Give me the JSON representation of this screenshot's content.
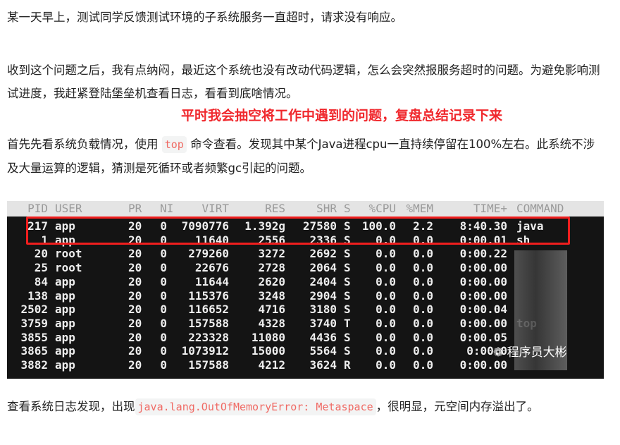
{
  "paragraphs": [
    {
      "text": "某一天早上，测试同学反馈测试环境的子系统服务一直超时，请求没有响应。"
    },
    {
      "text": "收到这个问题之后，我有点纳闷，最近这个系统也没有改动代码逻辑，怎么会突然报服务超时的问题。为避免影响测试进度，我赶紧登陆堡垒机查看日志，看看到底啥情况。"
    }
  ],
  "highlight": "平时我会抽空将工作中遇到的问题，复盘总结记录下来",
  "p3": {
    "before": "首先先看系统负载情况，使用",
    "code": "top",
    "after": "命令查看。发现其中某个Java进程cpu一直持续停留在100%左右。此系统不涉及大量运算的逻辑，猜测是死循环或者频繁gc引起的问题。"
  },
  "p4": {
    "before": "查看系统日志发现，出现",
    "code": "java.lang.OutOfMemoryError: Metaspace",
    "after": "，很明显，元空间内存溢出了。"
  },
  "terminal": {
    "headers": [
      "PID",
      "USER",
      "PR",
      "NI",
      "VIRT",
      "RES",
      "SHR",
      "S",
      "%CPU",
      "%MEM",
      "TIME+",
      "COMMAND"
    ],
    "rows": [
      [
        "217",
        "app",
        "20",
        "0",
        "7090776",
        "1.392g",
        "27580",
        "S",
        "100.0",
        "2.2",
        "8:40.30",
        "java"
      ],
      [
        "1",
        "app",
        "20",
        "0",
        "11640",
        "2556",
        "2336",
        "S",
        "0.0",
        "0.0",
        "0:00.01",
        "sh"
      ],
      [
        "20",
        "root",
        "20",
        "0",
        "279260",
        "3272",
        "2692",
        "S",
        "0.0",
        "0.0",
        "0:00.22",
        ""
      ],
      [
        "25",
        "root",
        "20",
        "0",
        "22676",
        "2728",
        "2064",
        "S",
        "0.0",
        "0.0",
        "0:00.00",
        ""
      ],
      [
        "84",
        "app",
        "20",
        "0",
        "11644",
        "2620",
        "2404",
        "S",
        "0.0",
        "0.0",
        "0:00.00",
        ""
      ],
      [
        "138",
        "app",
        "20",
        "0",
        "115376",
        "3248",
        "2904",
        "S",
        "0.0",
        "0.0",
        "0:00.00",
        ""
      ],
      [
        "2502",
        "app",
        "20",
        "0",
        "116652",
        "4716",
        "3180",
        "S",
        "0.0",
        "0.0",
        "0:00.04",
        ""
      ],
      [
        "3759",
        "app",
        "20",
        "0",
        "157588",
        "4328",
        "3740",
        "T",
        "0.0",
        "0.0",
        "0:00.00",
        "top"
      ],
      [
        "3855",
        "app",
        "20",
        "0",
        "223328",
        "11080",
        "4436",
        "S",
        "0.0",
        "0.0",
        "0:00.05",
        ""
      ],
      [
        "3865",
        "app",
        "20",
        "0",
        "1073912",
        "15000",
        "5564",
        "S",
        "0.0",
        "0.0",
        "0:00.0",
        ""
      ],
      [
        "3882",
        "app",
        "20",
        "0",
        "157588",
        "4212",
        "3624",
        "R",
        "0.0",
        "0.0",
        "0:00.00",
        ""
      ]
    ],
    "highlight_color": "#f01e1e",
    "watermark": "程序员大彬"
  }
}
